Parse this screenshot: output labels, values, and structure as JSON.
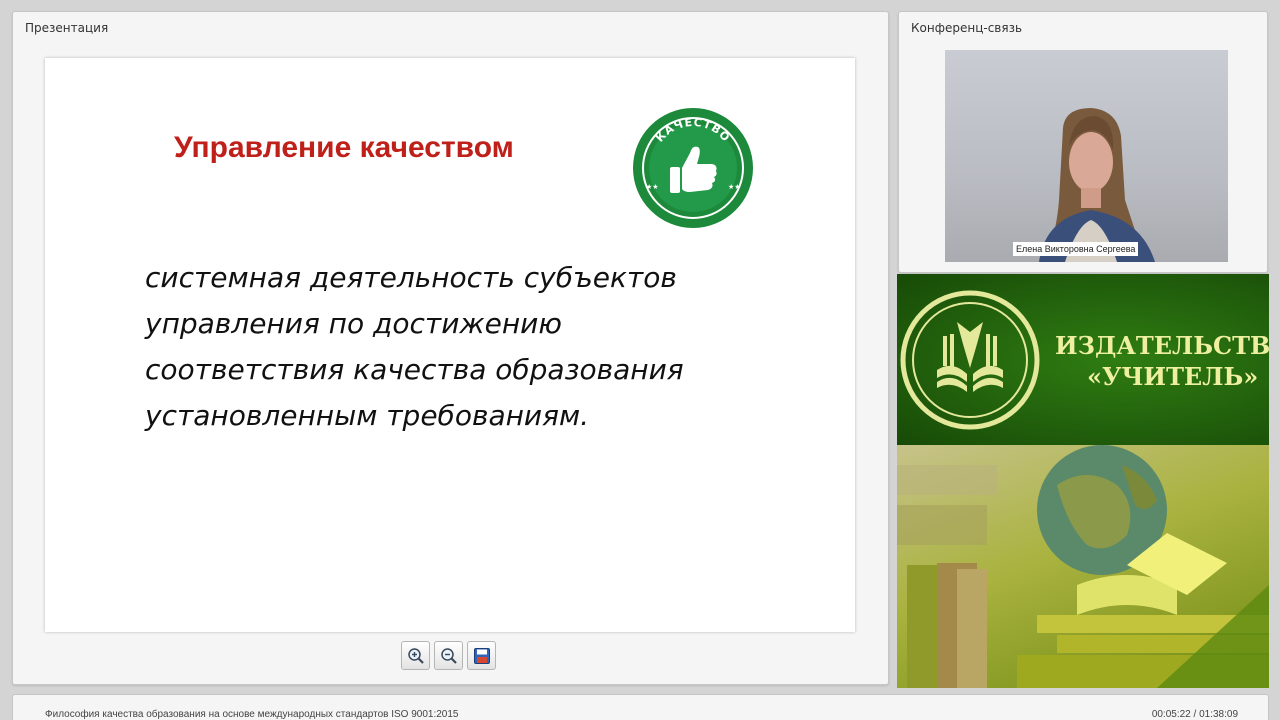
{
  "presentation": {
    "panel_title": "Презентация",
    "slide": {
      "title": "Управление качеством",
      "body": "системная деятельность субъектов управления по достижению соответствия качества образования установленным требованиям.",
      "badge_text": "КАЧЕСТВО"
    },
    "toolbar": {
      "zoom_in_icon": "zoom-in-icon",
      "zoom_out_icon": "zoom-out-icon",
      "save_icon": "save-icon"
    }
  },
  "conference": {
    "panel_title": "Конференц-связь",
    "speaker_name": "Елена Викторовна Сергеева"
  },
  "ad": {
    "publisher_line1": "ИЗДАТЕЛЬСТВО",
    "publisher_line2": "«УЧИТЕЛЬ»"
  },
  "footer": {
    "title": "Философия качества образования на основе  международных стандартов ISO 9001:2015",
    "time": "00:05:22 / 01:38:09"
  },
  "colors": {
    "slide_title": "#c0201a",
    "badge_green": "#1c8a3a",
    "ad_green": "#1f5a0b",
    "ad_text": "#eef0a0"
  }
}
